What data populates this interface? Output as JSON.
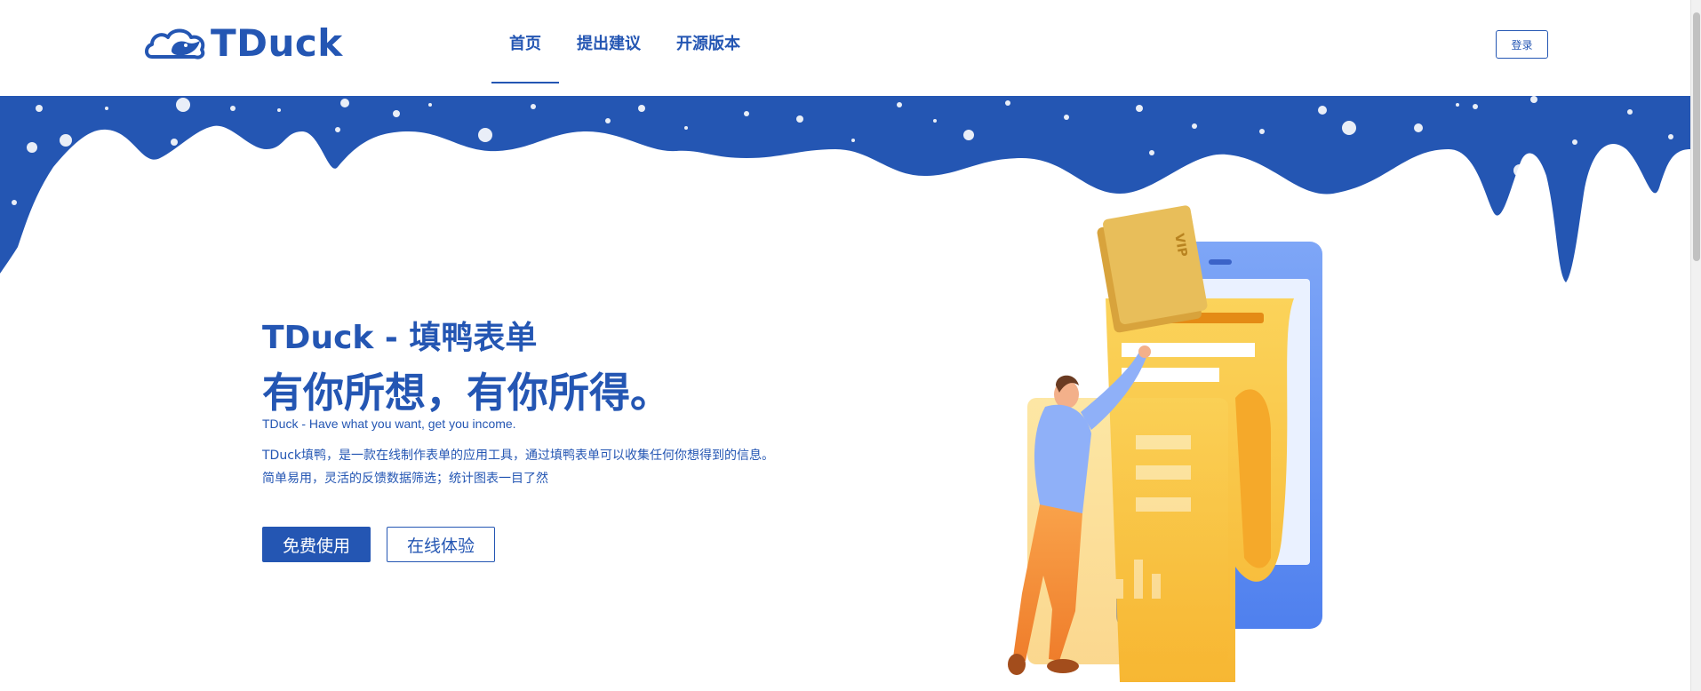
{
  "brand": {
    "name": "TDuck",
    "color": "#2456b3"
  },
  "nav": {
    "items": [
      {
        "label": "首页",
        "active": true
      },
      {
        "label": "提出建议",
        "active": false
      },
      {
        "label": "开源版本",
        "active": false
      }
    ]
  },
  "header": {
    "login_label": "登录"
  },
  "hero": {
    "title": "TDuck - 填鸭表单",
    "slogan": "有你所想，有你所得。",
    "subtitle_en": "TDuck - Have what you want, get you income.",
    "description_line1": "TDuck填鸭，是一款在线制作表单的应用工具，通过填鸭表单可以收集任何你想得到的信息。",
    "description_line2": "简单易用，灵活的反馈数据筛选；统计图表一目了然",
    "primary_button": "免费使用",
    "secondary_button": "在线体验"
  },
  "illustration": {
    "badge_text": "VIP"
  },
  "icons": [
    "duck-cloud-logo-icon"
  ],
  "colors": {
    "accent": "#2456b3",
    "illustration_yellow": "#f9c440",
    "illustration_blue": "#5b8cf0"
  }
}
